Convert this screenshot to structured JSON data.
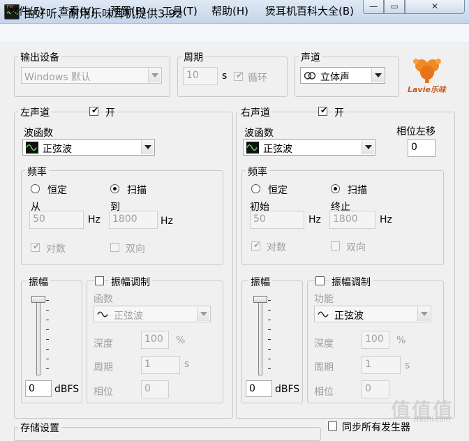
{
  "window": {
    "title": "由好听、耐用乐味耳机提供3.92",
    "icon_label": "TTG"
  },
  "menu": [
    "文件(F)",
    "查看(V)",
    "预置(P)",
    "工具(T)",
    "帮助(H)",
    "煲耳机百科大全(B)"
  ],
  "output": {
    "title": "输出设备",
    "device": "Windows 默认"
  },
  "period": {
    "title": "周期",
    "value": "10",
    "unit": "s",
    "loop_label": "循环",
    "loop_checked": true
  },
  "channel": {
    "title": "声道",
    "value": "立体声"
  },
  "logo": {
    "text": "Lavie乐味"
  },
  "left": {
    "title": "左声道",
    "enable_label": "开",
    "enabled": true,
    "wave_label": "波函数",
    "wave": "正弦波",
    "freq_title": "频率",
    "fixed_label": "恒定",
    "sweep_label": "扫描",
    "mode": "sweep",
    "from_label": "从",
    "to_label": "到",
    "from_value": "50",
    "to_value": "1800",
    "hz": "Hz",
    "log_label": "对数",
    "log_checked": true,
    "bidir_label": "双向",
    "bidir_checked": false,
    "amp_title": "振幅",
    "amp_value": "0",
    "amp_unit": "dBFS",
    "am_title": "振幅调制",
    "am_checked": false,
    "am_func_label": "函数",
    "am_func": "正弦波",
    "depth_label": "深度",
    "depth_value": "100",
    "depth_unit": "%",
    "period_label": "周期",
    "period_value": "1",
    "period_unit": "s",
    "phase_label": "相位",
    "phase_value": "0"
  },
  "right": {
    "title": "右声道",
    "enable_label": "开",
    "enabled": true,
    "wave_label": "波函数",
    "wave": "正弦波",
    "phase_shift_label": "相位左移",
    "phase_shift_value": "0",
    "freq_title": "频率",
    "fixed_label": "恒定",
    "sweep_label": "扫描",
    "mode": "sweep",
    "from_label": "初始",
    "to_label": "终止",
    "from_value": "50",
    "to_value": "1800",
    "hz": "Hz",
    "log_label": "对数",
    "log_checked": true,
    "bidir_label": "双向",
    "bidir_checked": false,
    "amp_title": "振幅",
    "amp_value": "0",
    "amp_unit": "dBFS",
    "am_title": "振幅调制",
    "am_checked": false,
    "am_func_label": "功能",
    "am_func": "正弦波",
    "depth_label": "深度",
    "depth_value": "100",
    "depth_unit": "%",
    "period_label": "周期",
    "period_value": "1",
    "period_unit": "s",
    "phase_label": "相位",
    "phase_value": "0"
  },
  "storage": {
    "title": "存储设置"
  },
  "sync": {
    "label": "同步所有发生器",
    "checked": false
  },
  "watermark": {
    "text": "值值值",
    "sub": "zhizhi.com"
  }
}
